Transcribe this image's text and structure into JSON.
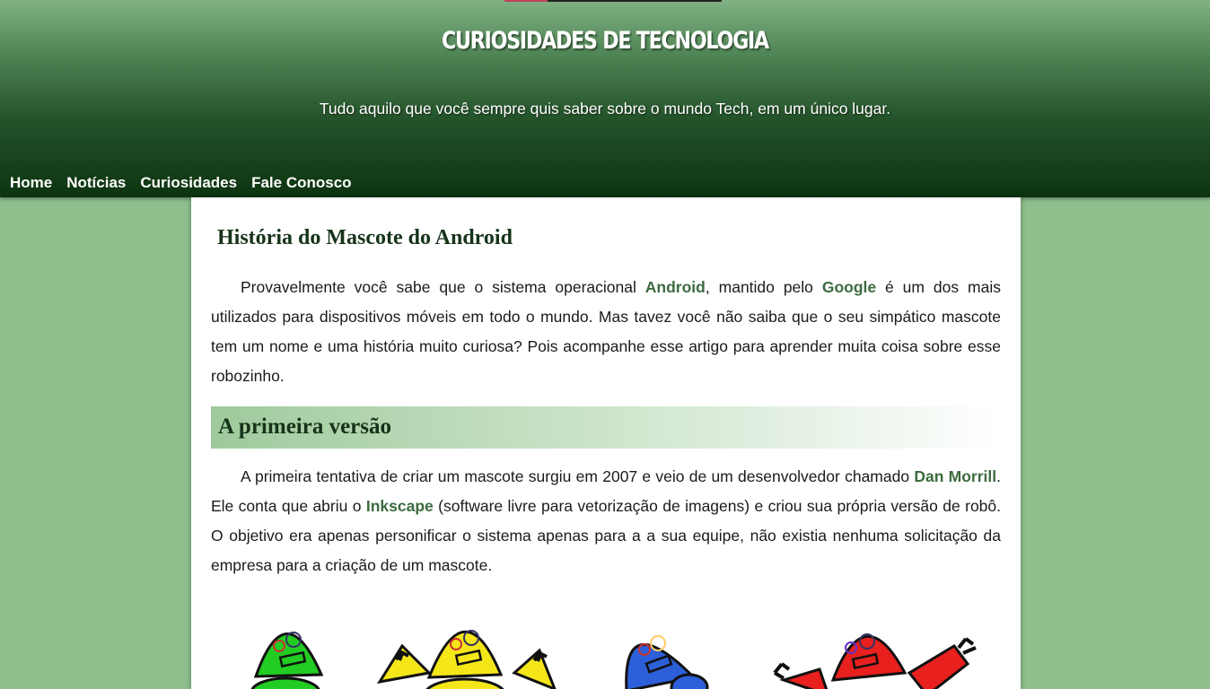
{
  "site": {
    "title": "CURIOSIDADES DE TECNOLOGIA",
    "tagline": "Tudo aquilo que você sempre quis saber sobre o mundo Tech, em um único lugar."
  },
  "nav": {
    "items": [
      {
        "label": "Home"
      },
      {
        "label": "Notícias"
      },
      {
        "label": "Curiosidades"
      },
      {
        "label": "Fale Conosco"
      }
    ]
  },
  "article": {
    "title": "História do Mascote do Android",
    "intro": {
      "t1": "Provavelmente você sabe que o sistema operacional ",
      "k1": "Android",
      "t2": ", mantido pelo ",
      "k2": "Google",
      "t3": " é um dos mais utilizados para dispositivos móveis em todo o mundo. Mas tavez você não saiba que o seu simpático mascote tem um nome e uma história muito curiosa? Pois acompanhe esse artigo para aprender muita coisa sobre esse robozinho."
    },
    "section": {
      "title": "A primeira versão",
      "t1": "A primeira tentativa de criar um mascote surgiu em 2007 e veio de um desenvolvedor chamado ",
      "k1": "Dan Morrill",
      "t2": ". Ele conta que abriu o ",
      "k2": "Inkscape",
      "t3": " (software livre para vetorização de imagens) e criou sua própria versão de robô. O objetivo era apenas personificar o sistema apenas para a a sua equipe, não existia nenhuma solicitação da empresa para a criação de um mascote."
    }
  },
  "colors": {
    "page_bg": "#8fbf8d",
    "header_dark": "#0d3410",
    "keyword": "#3d6b40",
    "heading": "#16331a",
    "mascots": [
      "#22cc22",
      "#f5e61a",
      "#2d5fd8",
      "#e8201e"
    ]
  }
}
